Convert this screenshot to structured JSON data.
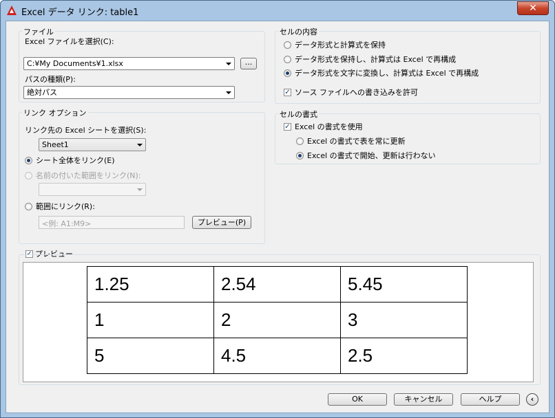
{
  "window": {
    "title": "Excel データ リンク: table1",
    "close_label": "✕"
  },
  "file_group": {
    "legend": "ファイル",
    "select_label": "Excel ファイルを選択(C):",
    "file_path": "C:¥My Documents¥1.xlsx",
    "browse_label": "...",
    "path_type_label": "パスの種類(P):",
    "path_type_value": "絶対パス"
  },
  "link_group": {
    "legend": "リンク オプション",
    "sheet_label": "リンク先の Excel シートを選択(S):",
    "sheet_value": "Sheet1",
    "opt_entire_sheet": "シート全体をリンク(E)",
    "opt_named_range": "名前の付いた範囲をリンク(N):",
    "opt_range": "範囲にリンク(R):",
    "range_placeholder": "<例: A1:M9>",
    "preview_button": "プレビュー(P)"
  },
  "cell_content_group": {
    "legend": "セルの内容",
    "opt1": "データ形式と計算式を保持",
    "opt2": "データ形式を保持し、計算式は Excel で再構成",
    "opt3": "データ形式を文字に変換し、計算式は Excel で再構成",
    "allow_write": "ソース ファイルへの書き込みを許可"
  },
  "cell_format_group": {
    "legend": "セルの書式",
    "use_excel_format": "Excel の書式を使用",
    "opt_always_update": "Excel の書式で表を常に更新",
    "opt_start_no_update": "Excel の書式で開始、更新は行わない"
  },
  "preview": {
    "label": "プレビュー",
    "rows": [
      [
        "1.25",
        "2.54",
        "5.45"
      ],
      [
        "1",
        "2",
        "3"
      ],
      [
        "5",
        "4.5",
        "2.5"
      ]
    ]
  },
  "buttons": {
    "ok": "OK",
    "cancel": "キャンセル",
    "help": "ヘルプ",
    "info": "‹"
  }
}
